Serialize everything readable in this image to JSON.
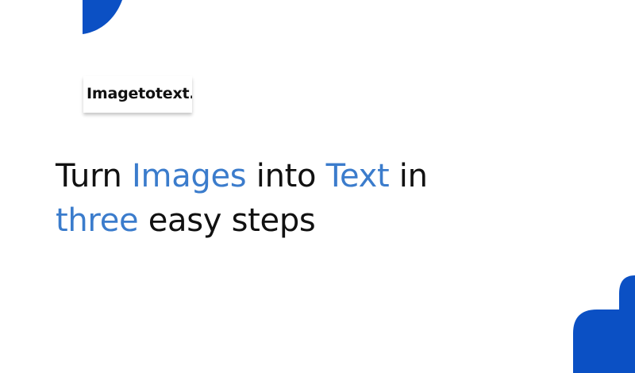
{
  "brand": {
    "name": "Imagetotext.i"
  },
  "headline": {
    "parts": [
      "Turn",
      "Images",
      "into",
      "Text",
      "in",
      "three",
      "easy steps"
    ]
  },
  "colors": {
    "accent": "#3b7ccc",
    "shape": "#0b50c4",
    "text": "#111111",
    "background": "#ffffff"
  }
}
